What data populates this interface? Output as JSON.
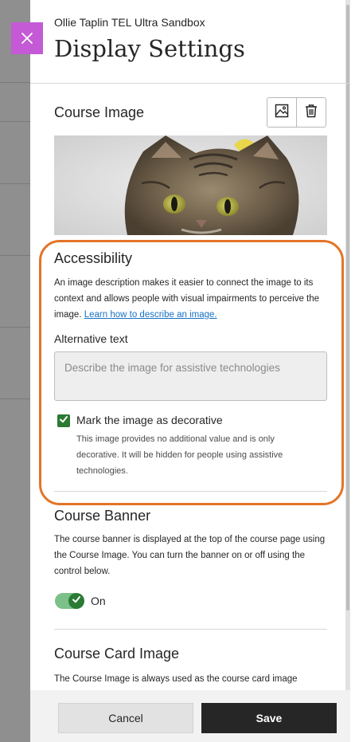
{
  "panel": {
    "course_name": "Ollie Taplin TEL Ultra Sandbox",
    "title": "Display Settings"
  },
  "icons": {
    "close": "close-icon",
    "replace_image": "image-icon",
    "delete_image": "trash-icon",
    "checkmark": "check-icon"
  },
  "course_image": {
    "heading": "Course Image",
    "description": "photo of a tabby cat with a yellow party hat"
  },
  "accessibility": {
    "heading": "Accessibility",
    "intro_text": "An image description makes it easier to connect the image to its context and allows people with visual impairments to perceive the image.",
    "learn_link": "Learn how to describe an image.",
    "alt_label": "Alternative text",
    "alt_placeholder": "Describe the image for assistive technologies",
    "alt_value": "",
    "decorative_label": "Mark the image as decorative",
    "decorative_checked": true,
    "decorative_help": "This image provides no additional value and is only decorative. It will be hidden for people using assistive technologies."
  },
  "course_banner": {
    "heading": "Course Banner",
    "description": "The course banner is displayed at the top of the course page using the Course Image. You can turn the banner on or off using the control below.",
    "toggle_state": "On",
    "enabled": true
  },
  "course_card": {
    "heading": "Course Card Image",
    "description": "The Course Image is always used as the course card image"
  },
  "footer": {
    "cancel_label": "Cancel",
    "save_label": "Save"
  },
  "colors": {
    "close_button": "#c45ad6",
    "highlight_ring": "#e47427",
    "check_green": "#2a7a34",
    "toggle_track": "#7cc08a",
    "link": "#1871c4",
    "save_button": "#262626"
  }
}
